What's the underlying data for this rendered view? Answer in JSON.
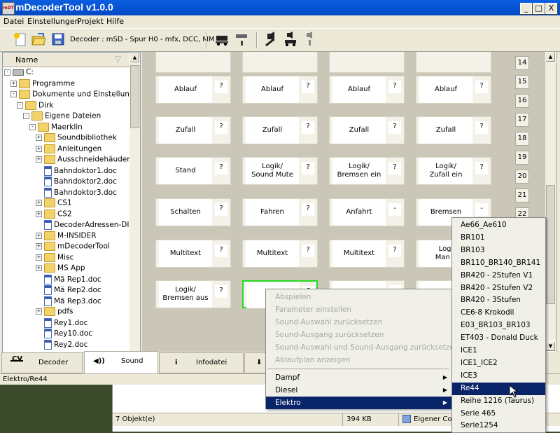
{
  "window": {
    "title": "mDecoderTool v1.0.0",
    "app_icon_text": "mDT",
    "controls": {
      "minimize": "_",
      "maximize": "□",
      "close": "X"
    }
  },
  "menu": [
    "Datei",
    "Einstellungen",
    "Projekt",
    "Hilfe"
  ],
  "toolbar": {
    "decoder_label": "Decoder : mSD - Spur H0 - mfx, DCC, MM",
    "icons": [
      "new-document-icon",
      "open-folder-icon",
      "save-disk-icon",
      "locomotive-icon",
      "locomotive-info-icon",
      "sound-edit-icon",
      "sound-locomotive-icon",
      "sound-info-icon"
    ]
  },
  "tree": {
    "header": "Name",
    "rows": [
      {
        "label": "C:",
        "type": "drive",
        "exp": "-",
        "indent": 0
      },
      {
        "label": "Programme",
        "type": "folder",
        "exp": "+",
        "indent": 1
      },
      {
        "label": "Dokumente und Einstellun...",
        "type": "folder",
        "exp": "-",
        "indent": 1
      },
      {
        "label": "Dirk",
        "type": "folder",
        "exp": "-",
        "indent": 2
      },
      {
        "label": "Eigene Dateien",
        "type": "folder",
        "exp": "-",
        "indent": 3
      },
      {
        "label": "Maerklin",
        "type": "folder",
        "exp": "-",
        "indent": 4
      },
      {
        "label": "Soundbibliothek",
        "type": "folder",
        "exp": "+",
        "indent": 5
      },
      {
        "label": "Anleitungen",
        "type": "folder",
        "exp": "+",
        "indent": 5
      },
      {
        "label": "Ausschneidehäuder",
        "type": "folder",
        "exp": "+",
        "indent": 5
      },
      {
        "label": "Bahndoktor1.doc",
        "type": "doc",
        "exp": "",
        "indent": 5
      },
      {
        "label": "Bahndoktor2.doc",
        "type": "doc",
        "exp": "",
        "indent": 5
      },
      {
        "label": "Bahndoktor3.doc",
        "type": "doc",
        "exp": "",
        "indent": 5
      },
      {
        "label": "CS1",
        "type": "folder",
        "exp": "+",
        "indent": 5
      },
      {
        "label": "CS2",
        "type": "folder",
        "exp": "+",
        "indent": 5
      },
      {
        "label": "DecoderAdressen-DI...",
        "type": "doc",
        "exp": "",
        "indent": 5
      },
      {
        "label": "M-INSIDER",
        "type": "folder",
        "exp": "+",
        "indent": 5
      },
      {
        "label": "mDecoderTool",
        "type": "folder",
        "exp": "+",
        "indent": 5
      },
      {
        "label": "Misc",
        "type": "folder",
        "exp": "+",
        "indent": 5
      },
      {
        "label": "MS App",
        "type": "folder",
        "exp": "+",
        "indent": 5
      },
      {
        "label": "Mä Rep1.doc",
        "type": "doc",
        "exp": "",
        "indent": 5
      },
      {
        "label": "Mä Rep2.doc",
        "type": "doc",
        "exp": "",
        "indent": 5
      },
      {
        "label": "Mä Rep3.doc",
        "type": "doc",
        "exp": "",
        "indent": 5
      },
      {
        "label": "pdfs",
        "type": "folder",
        "exp": "+",
        "indent": 5
      },
      {
        "label": "Rey1.doc",
        "type": "doc",
        "exp": "",
        "indent": 5
      },
      {
        "label": "Rey10.doc",
        "type": "doc",
        "exp": "",
        "indent": 5
      },
      {
        "label": "Rey2.doc",
        "type": "doc",
        "exp": "",
        "indent": 5
      }
    ]
  },
  "tabs": [
    {
      "icon": "CV",
      "label": "Decoder"
    },
    {
      "icon": "◀))",
      "label": "Sound"
    },
    {
      "icon": "i",
      "label": "Infodatei"
    },
    {
      "icon": "⬇",
      "label": ""
    }
  ],
  "status": {
    "path": "Elektro/Re44"
  },
  "grid": {
    "rows": [
      [
        {
          "l": "Ablauf",
          "q": "?"
        },
        {
          "l": "Ablauf",
          "q": "?"
        },
        {
          "l": "Ablauf",
          "q": "?"
        },
        {
          "l": "Ablauf",
          "q": "?"
        }
      ],
      [
        {
          "l": "Zufall",
          "q": "?"
        },
        {
          "l": "Zufall",
          "q": "?"
        },
        {
          "l": "Zufall",
          "q": "?"
        },
        {
          "l": "Zufall",
          "q": "?"
        }
      ],
      [
        {
          "l": "Stand",
          "q": "?"
        },
        {
          "l": "Logik/\nSound Mute",
          "q": "?"
        },
        {
          "l": "Logik/\nBremsen ein",
          "q": "?"
        },
        {
          "l": "Logik/\nZufall ein",
          "q": "?"
        }
      ],
      [
        {
          "l": "Schalten",
          "q": "?"
        },
        {
          "l": "Fahren",
          "q": "?"
        },
        {
          "l": "Anfahrt",
          "q": "-"
        },
        {
          "l": "Bremsen",
          "q": "-"
        }
      ],
      [
        {
          "l": "Multitext",
          "q": "?"
        },
        {
          "l": "Multitext",
          "q": "?"
        },
        {
          "l": "Multitext",
          "q": "?"
        },
        {
          "l": "Logi\nMan S",
          "q": ""
        }
      ],
      [
        {
          "l": "Logik/\nBremsen aus",
          "q": "?"
        },
        {
          "l": "",
          "q": "?"
        },
        {
          "l": "",
          "q": ""
        },
        {
          "l": "",
          "q": ""
        }
      ]
    ],
    "numbers": [
      "14",
      "15",
      "16",
      "17",
      "18",
      "19",
      "20",
      "21",
      "22"
    ]
  },
  "context_menu": {
    "disabled": [
      "Abspielen",
      "Parameter einstellen",
      "Sound-Auswahl zurücksetzen",
      "Sound-Ausgang zurücksetzen",
      "Sound-Auswahl und Sound-Ausgang zurücksetzen",
      "Ablaufplan anzeigen"
    ],
    "submenus": [
      "Dampf",
      "Diesel",
      "Elektro"
    ]
  },
  "submenu_elektro": [
    "Ae66_Ae610",
    "BR101",
    "BR103",
    "BR110_BR140_BR141",
    "BR420 - 2Stufen V1",
    "BR420 - 2Stufen V2",
    "BR420 - 3Stufen",
    "CE6-8 Krokodil",
    "E03_BR103_BR103",
    "ET403 - Donald Duck",
    "ICE1",
    "ICE1_ICE2",
    "ICE3",
    "Re44",
    "Reihe 1216 (Taurus)",
    "Serie 465",
    "Serie1254"
  ],
  "explorer": {
    "objects": "7 Objekt(e)",
    "size": "394 KB",
    "location": "Eigener Co"
  }
}
